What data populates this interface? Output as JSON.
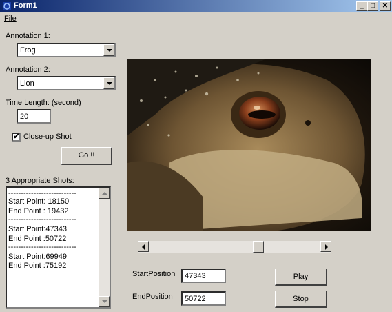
{
  "window": {
    "title": "Form1",
    "icon": "app-icon",
    "controls": [
      "minimize-icon",
      "maximize-icon",
      "close-icon"
    ]
  },
  "menu": {
    "file": "File"
  },
  "annotation1": {
    "label": "Annotation 1:",
    "value": "Frog"
  },
  "annotation2": {
    "label": "Annotation 2:",
    "value": "Lion"
  },
  "time_length": {
    "label": "Time Length: (second)",
    "value": "20"
  },
  "closeup": {
    "label": "Close-up Shot",
    "checked": true
  },
  "go_button": "Go !!",
  "shots": {
    "label": "3 Appropriate Shots:",
    "lines": [
      "---------------------------",
      "Start Point: 18150",
      "End Point : 19432",
      "---------------------------",
      "Start Point:47343",
      "End Point :50722",
      "---------------------------",
      "Start Point:69949",
      "End Point :75192"
    ]
  },
  "video": {
    "content": "close-up of a frog"
  },
  "position_slider": {
    "value_fraction": 0.65
  },
  "start_position": {
    "label": "StartPosition",
    "value": "47343"
  },
  "end_position": {
    "label": "EndPosition",
    "value": "50722"
  },
  "play_button": "Play",
  "stop_button": "Stop",
  "colors": {
    "titlebar_start": "#0a246a",
    "titlebar_end": "#a6caf0",
    "face": "#d4d0c8"
  }
}
